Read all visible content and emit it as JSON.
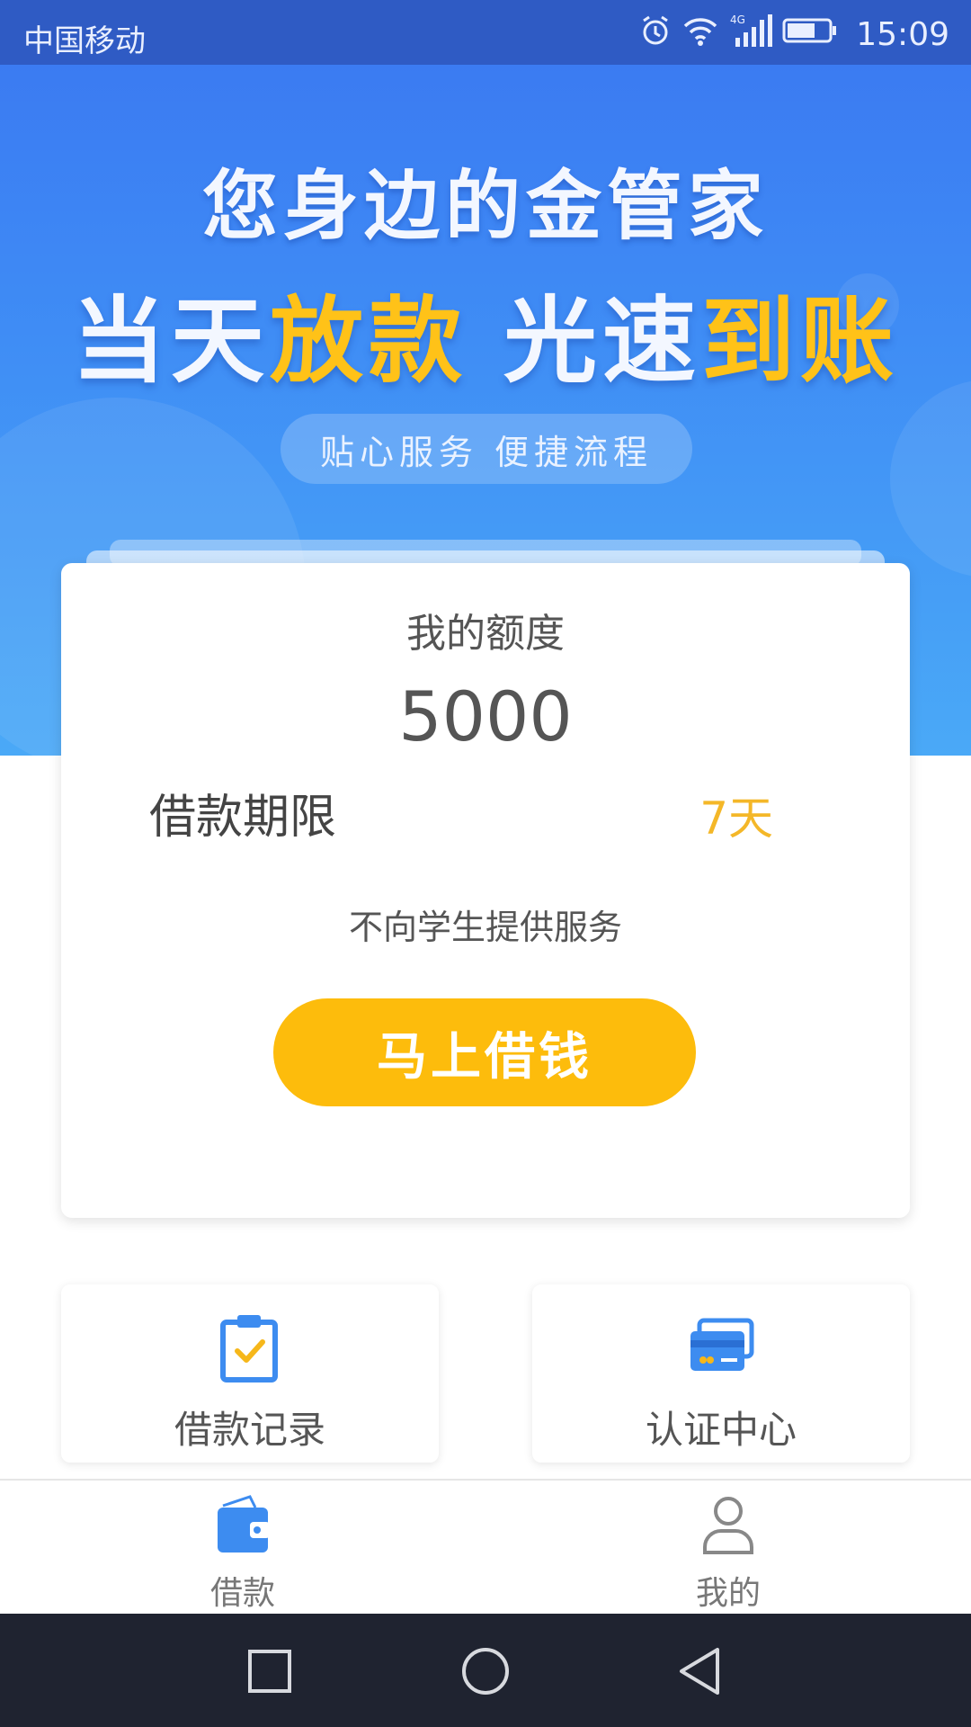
{
  "status_bar": {
    "carrier": "中国移动",
    "network": "4G",
    "time": "15:09",
    "icons": [
      "alarm-icon",
      "wifi-icon",
      "signal-icon",
      "battery-icon"
    ]
  },
  "banner": {
    "headline1": "您身边的金管家",
    "headline2": {
      "part1": "当天",
      "part2": "放款",
      "part3": "光速",
      "part4": "到账"
    },
    "tagline": "贴心服务 便捷流程"
  },
  "card": {
    "quota_label": "我的额度",
    "quota_value": "5000",
    "term_label": "借款期限",
    "term_value": "7天",
    "notice": "不向学生提供服务",
    "borrow_button": "马上借钱"
  },
  "features": [
    {
      "label": "借款记录",
      "icon": "clipboard-check-icon"
    },
    {
      "label": "认证中心",
      "icon": "credit-card-icon"
    }
  ],
  "bottom_nav": [
    {
      "label": "借款",
      "icon": "wallet-icon",
      "active": true
    },
    {
      "label": "我的",
      "icon": "user-icon",
      "active": false
    }
  ],
  "system_nav": [
    "recent-apps-icon",
    "home-icon",
    "back-icon"
  ],
  "colors": {
    "primary_blue": "#3b7bf2",
    "accent_yellow": "#fdbc0c",
    "status_bar": "#2f5bc4"
  }
}
